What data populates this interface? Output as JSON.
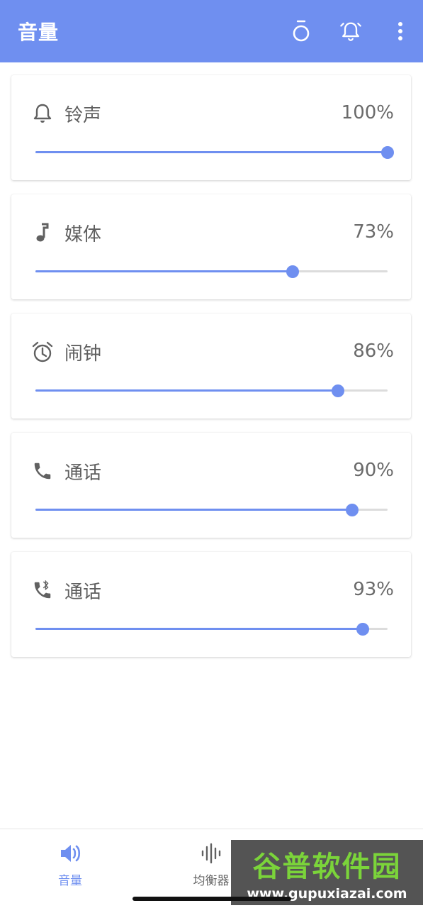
{
  "appbar": {
    "title": "音量",
    "actions": [
      {
        "icon": "timer-icon"
      },
      {
        "icon": "alarm-bell-icon"
      },
      {
        "icon": "more-vert-icon"
      }
    ]
  },
  "colors": {
    "accent": "#6f8ff0",
    "track": "#dcdcdc",
    "text": "#5f5f5f"
  },
  "volumes": [
    {
      "icon": "bell-icon",
      "label": "铃声",
      "value_text": "100%",
      "level": 1.0
    },
    {
      "icon": "music-note-icon",
      "label": "媒体",
      "value_text": "73%",
      "level": 0.73
    },
    {
      "icon": "alarm-clock-icon",
      "label": "闹钟",
      "value_text": "86%",
      "level": 0.86
    },
    {
      "icon": "phone-icon",
      "label": "通话",
      "value_text": "90%",
      "level": 0.9
    },
    {
      "icon": "bluetooth-phone-icon",
      "label": "通话",
      "value_text": "93%",
      "level": 0.93
    }
  ],
  "bottom_nav": {
    "items": [
      {
        "icon": "volume-icon",
        "label": "音量",
        "active": true
      },
      {
        "icon": "equalizer-icon",
        "label": "均衡器",
        "active": false
      },
      {
        "icon": "settings-icon",
        "label": "",
        "active": false
      }
    ]
  },
  "watermark": {
    "title": "谷普软件园",
    "url": "www.gupuxiazai.com"
  }
}
